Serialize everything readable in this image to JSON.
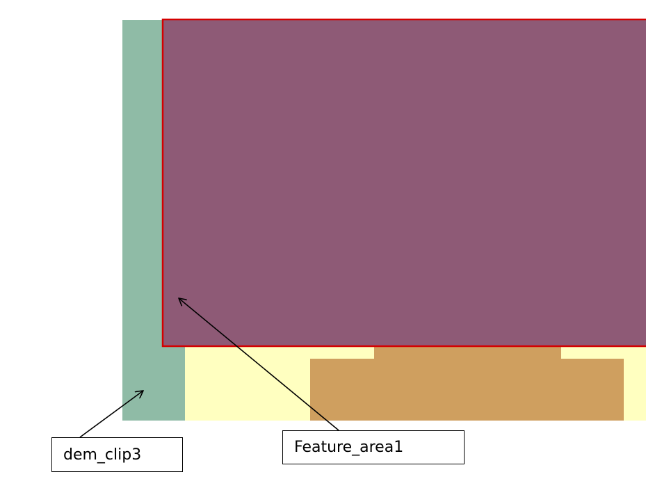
{
  "colors": {
    "background": "#ffffff",
    "dem_green": "#8fbba6",
    "dem_yellow": "#ffffc0",
    "dem_orange": "#cf9f5f",
    "feature_fill": "#8e5a76",
    "feature_outline": "#d40000",
    "callout_border": "#000000",
    "arrow": "#000000"
  },
  "callouts": [
    {
      "label": "dem_clip3"
    },
    {
      "label": "Feature_area1"
    }
  ]
}
